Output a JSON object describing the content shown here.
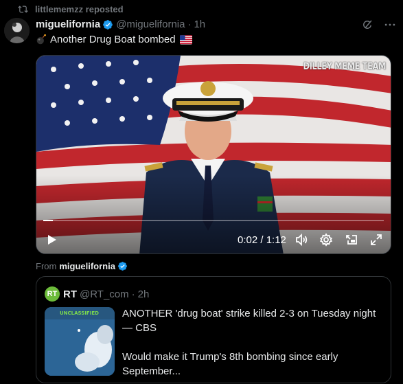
{
  "repost": {
    "text": "littlememzz reposted"
  },
  "tweet": {
    "display_name": "miguelifornia",
    "handle": "@miguelifornia",
    "separator": "·",
    "time": "1h",
    "text": "Another Drug Boat bombed"
  },
  "video": {
    "watermark": "DILLEY MEME TEAM",
    "timecode": "0:02 / 1:12",
    "progress": 0.028
  },
  "from": {
    "label": "From",
    "name": "miguelifornia"
  },
  "quote": {
    "logo_text": "RT",
    "display_name": "RT",
    "handle": "@RT_com",
    "separator": "·",
    "time": "2h",
    "thumb_label": "UNCLASSIFIED",
    "line1": "ANOTHER 'drug boat' strike killed 2-3 on Tuesday night — CBS",
    "line2": "Would make it Trump's 8th bombing since early September..."
  },
  "colors": {
    "verified": "#1d9bf0",
    "rt_green": "#6cbb3a",
    "muted": "#71767b"
  },
  "icons": [
    "repost-icon",
    "verified-badge-icon",
    "grok-icon",
    "more-icon",
    "bomb-emoji-icon",
    "us-flag-emoji-icon",
    "play-icon",
    "volume-icon",
    "settings-icon",
    "pip-icon",
    "fullscreen-icon"
  ]
}
